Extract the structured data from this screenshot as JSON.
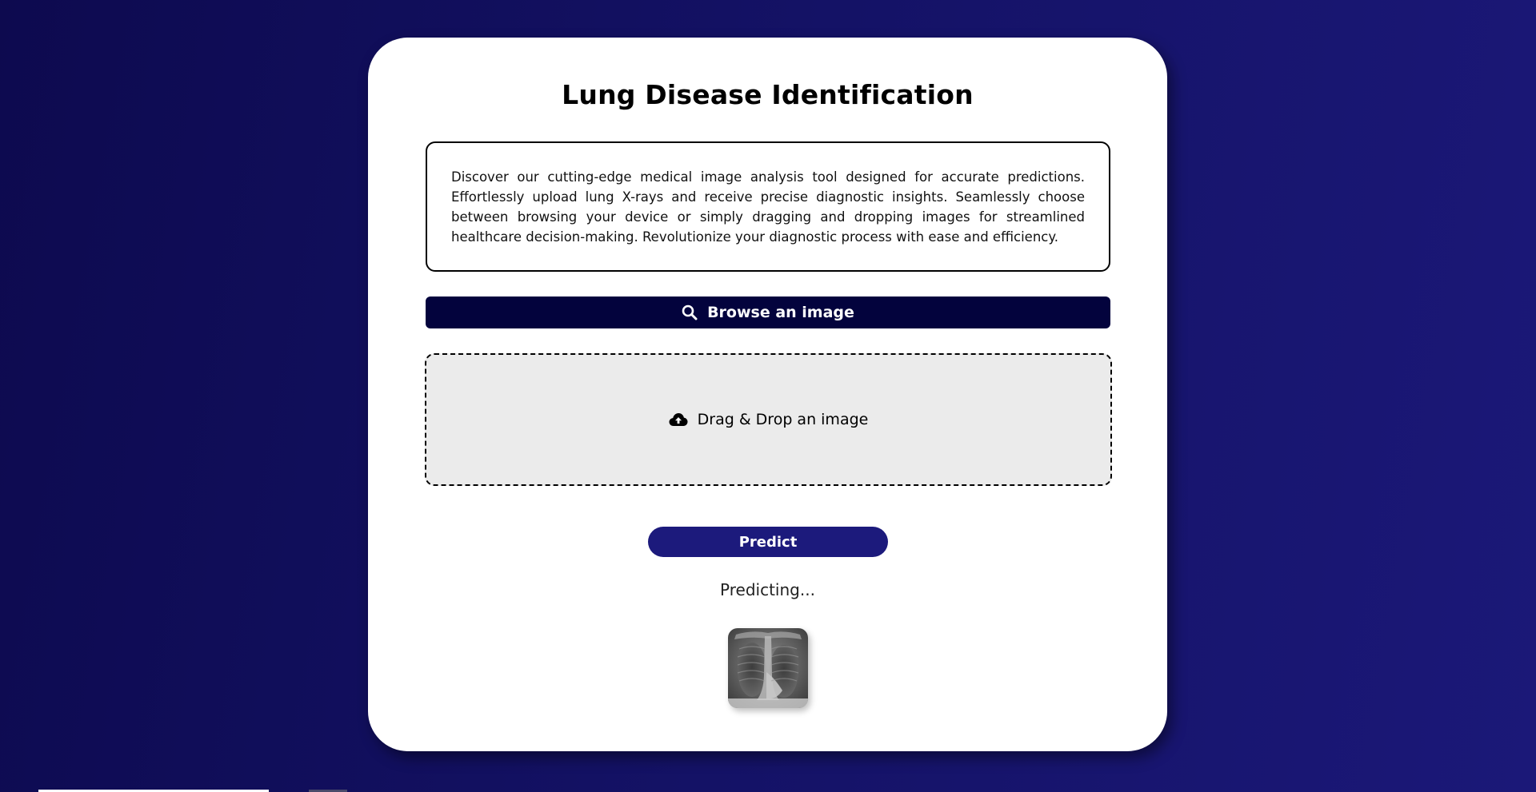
{
  "title": "Lung Disease Identification",
  "description": "Discover our cutting-edge medical image analysis tool designed for accurate predictions. Effortlessly upload lung X-rays and receive precise diagnostic insights. Seamlessly choose between browsing your device or simply dragging and dropping images for streamlined healthcare decision-making. Revolutionize your diagnostic process with ease and efficiency.",
  "browse": {
    "label": "Browse an image",
    "icon": "search-icon"
  },
  "dropzone": {
    "label": "Drag & Drop an image",
    "icon": "cloud-upload-icon"
  },
  "predict": {
    "label": "Predict"
  },
  "status": "Predicting...",
  "preview": {
    "icon": "chest-xray-thumbnail"
  },
  "colors": {
    "background_start": "#0d0a4f",
    "background_end": "#1b1878",
    "browse_button": "#03033d",
    "predict_button": "#1c1a7c",
    "dropzone_bg": "#ebebeb"
  }
}
